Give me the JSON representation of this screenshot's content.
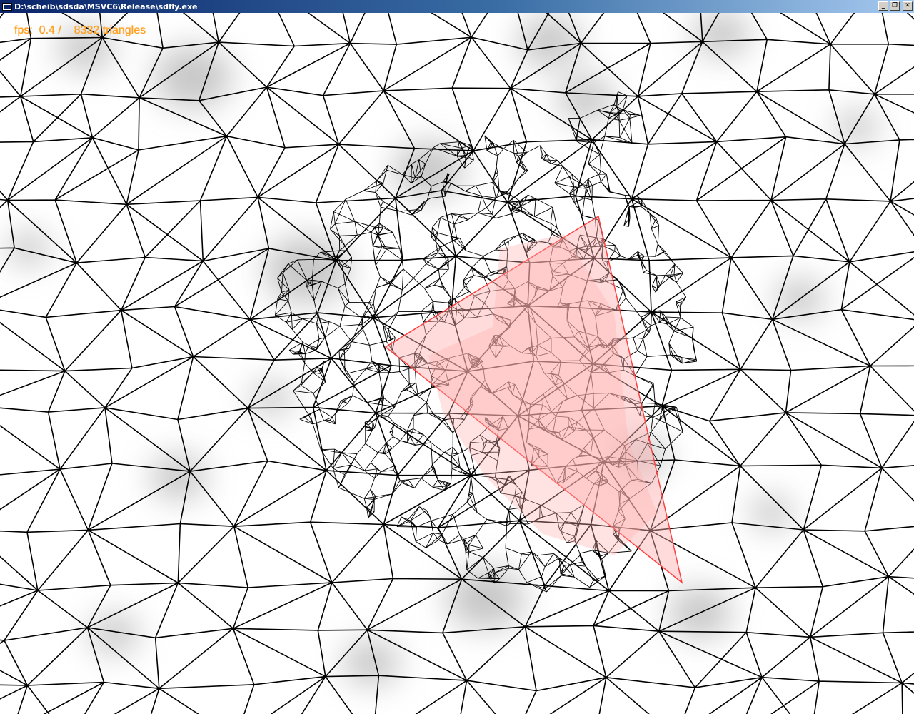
{
  "window": {
    "title": "D:\\scheib\\sdsda\\MSVC6\\Release\\sdfly.exe",
    "buttons": {
      "minimize": "_",
      "restore": "❐",
      "close": "✕"
    }
  },
  "hud": {
    "stats_text": "fps:  0.4 /    8332 triangles"
  },
  "colors": {
    "title_bar": "#0a246a",
    "hud_text": "#ffa020",
    "wireframe": "#000000",
    "frustum": "#ff4040",
    "frustum_fill": "#ffb0b0"
  }
}
